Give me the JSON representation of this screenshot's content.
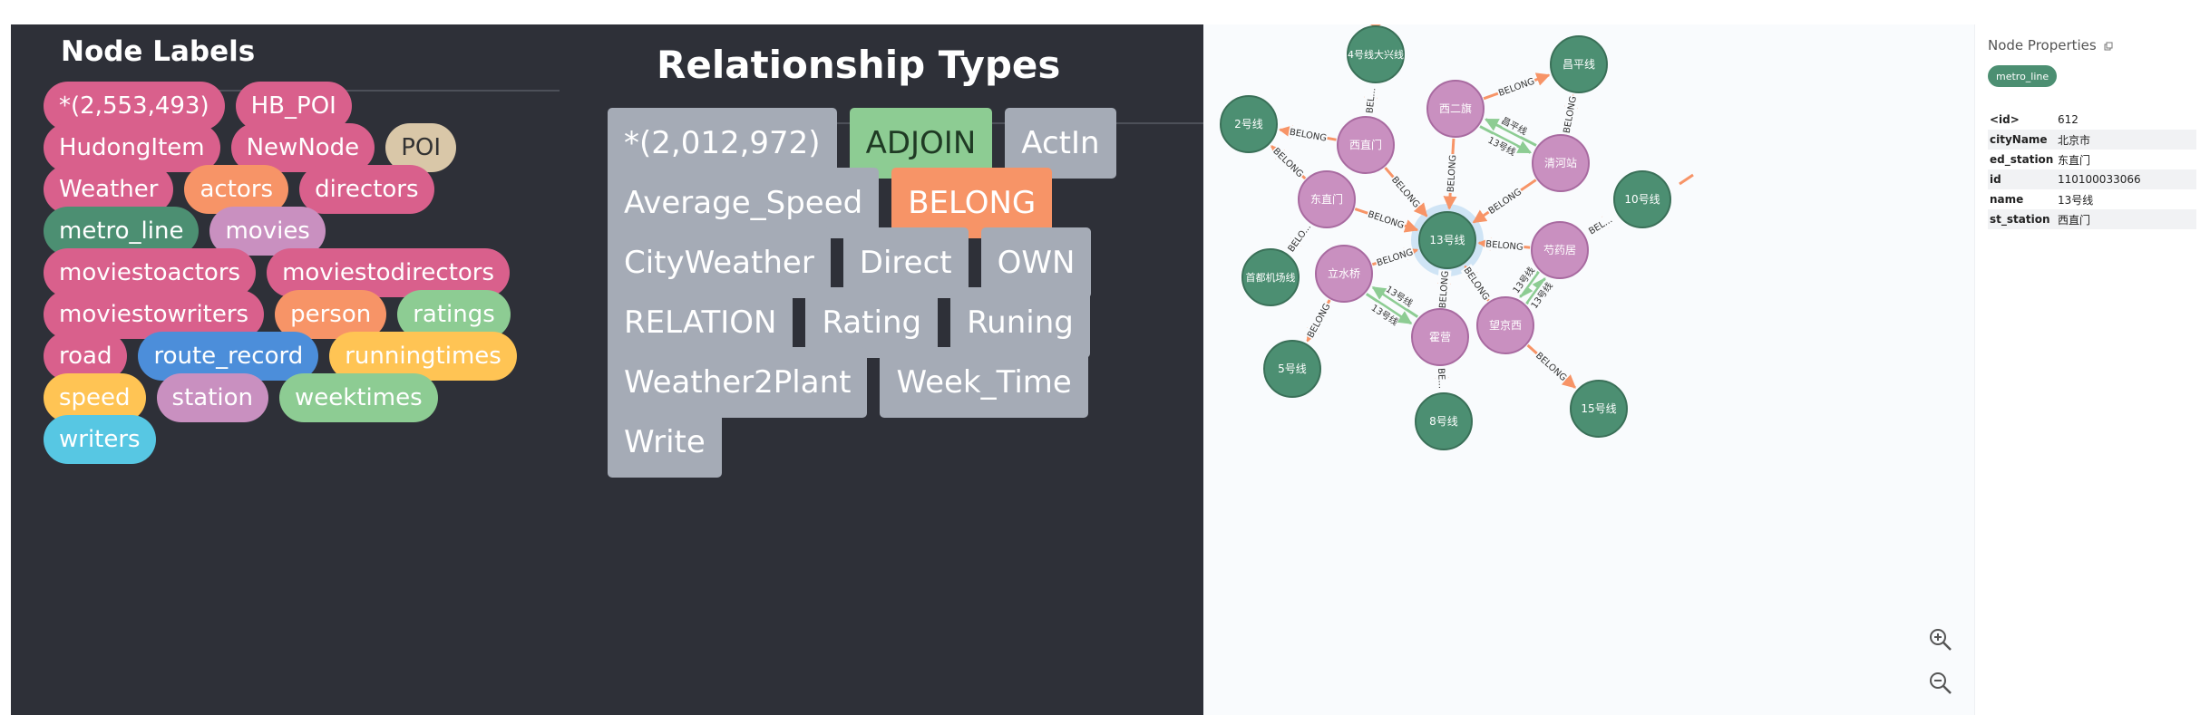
{
  "node_labels": {
    "title": "Node Labels",
    "items": [
      {
        "label": "*(2,553,493)",
        "color": "#d9608c"
      },
      {
        "label": "HB_POI",
        "color": "#d9608c"
      },
      {
        "label": "HudongItem",
        "color": "#d9608c"
      },
      {
        "label": "NewNode",
        "color": "#d9608c"
      },
      {
        "label": "POI",
        "color": "#d9c7a8"
      },
      {
        "label": "Weather",
        "color": "#d9608c"
      },
      {
        "label": "actors",
        "color": "#f79467"
      },
      {
        "label": "directors",
        "color": "#d9608c"
      },
      {
        "label": "metro_line",
        "color": "#4c8f72"
      },
      {
        "label": "movies",
        "color": "#c990c0"
      },
      {
        "label": "moviestoactors",
        "color": "#d9608c"
      },
      {
        "label": "moviestodirectors",
        "color": "#d9608c"
      },
      {
        "label": "moviestowriters",
        "color": "#d9608c"
      },
      {
        "label": "person",
        "color": "#f79467"
      },
      {
        "label": "ratings",
        "color": "#8dcc93"
      },
      {
        "label": "road",
        "color": "#d9608c"
      },
      {
        "label": "route_record",
        "color": "#4c8eda"
      },
      {
        "label": "runningtimes",
        "color": "#ffc454"
      },
      {
        "label": "speed",
        "color": "#ffc454"
      },
      {
        "label": "station",
        "color": "#c990c0"
      },
      {
        "label": "weektimes",
        "color": "#8dcc93"
      },
      {
        "label": "writers",
        "color": "#57c7e3"
      }
    ]
  },
  "relationship_types": {
    "title": "Relationship Types",
    "items": [
      {
        "label": "*(2,012,972)",
        "color": "#a5abb6"
      },
      {
        "label": "ADJOIN",
        "color": "#8dcc93"
      },
      {
        "label": "ActIn",
        "color": "#a5abb6"
      },
      {
        "label": "Average_Speed",
        "color": "#a5abb6"
      },
      {
        "label": "BELONG",
        "color": "#f79467"
      },
      {
        "label": "CityWeather",
        "color": "#a5abb6"
      },
      {
        "label": "Direct",
        "color": "#a5abb6"
      },
      {
        "label": "OWN",
        "color": "#a5abb6"
      },
      {
        "label": "RELATION",
        "color": "#a5abb6"
      },
      {
        "label": "Rating",
        "color": "#a5abb6"
      },
      {
        "label": "Runing",
        "color": "#a5abb6"
      },
      {
        "label": "Weather2Plant",
        "color": "#a5abb6"
      },
      {
        "label": "Week_Time",
        "color": "#a5abb6"
      },
      {
        "label": "Write",
        "color": "#a5abb6"
      }
    ]
  },
  "graph": {
    "colors": {
      "line": "#4c8f72",
      "station": "#c990c0",
      "belong": "#f79467",
      "adjoin": "#8dcc93",
      "selected_halo": "#cfe4f5"
    },
    "nodes": [
      {
        "id": "n13",
        "label": "13号线",
        "type": "line",
        "selected": true
      },
      {
        "id": "n4",
        "label": "4号线大兴线",
        "type": "line"
      },
      {
        "id": "nCp",
        "label": "昌平线",
        "type": "line"
      },
      {
        "id": "n2",
        "label": "2号线",
        "type": "line"
      },
      {
        "id": "n10",
        "label": "10号线",
        "type": "line"
      },
      {
        "id": "nAir",
        "label": "首都机场线",
        "type": "line"
      },
      {
        "id": "n5",
        "label": "5号线",
        "type": "line"
      },
      {
        "id": "n8",
        "label": "8号线",
        "type": "line"
      },
      {
        "id": "n15",
        "label": "15号线",
        "type": "line"
      },
      {
        "id": "sXzm",
        "label": "西直门",
        "type": "station"
      },
      {
        "id": "sXeq",
        "label": "西二旗",
        "type": "station"
      },
      {
        "id": "sQhz",
        "label": "清河站",
        "type": "station"
      },
      {
        "id": "sDzm",
        "label": "东直门",
        "type": "station"
      },
      {
        "id": "sSyj",
        "label": "芍药居",
        "type": "station"
      },
      {
        "id": "sLsq",
        "label": "立水桥",
        "type": "station"
      },
      {
        "id": "sHy",
        "label": "霍营",
        "type": "station"
      },
      {
        "id": "sWjx",
        "label": "望京西",
        "type": "station"
      }
    ],
    "edges": [
      {
        "from": "sXzm",
        "to": "n4",
        "label": "BEL...",
        "type": "belong"
      },
      {
        "from": "sXzm",
        "to": "n2",
        "label": "BELONG",
        "type": "belong"
      },
      {
        "from": "sXzm",
        "to": "n13",
        "label": "BELONG",
        "type": "belong"
      },
      {
        "from": "sXeq",
        "to": "nCp",
        "label": "BELONG",
        "type": "belong"
      },
      {
        "from": "sXeq",
        "to": "n13",
        "label": "BELONG",
        "type": "belong"
      },
      {
        "from": "sXeq",
        "to": "sQhz",
        "label": "13号线",
        "type": "adjoin"
      },
      {
        "from": "sQhz",
        "to": "sXeq",
        "label": "昌平线",
        "type": "adjoin"
      },
      {
        "from": "sQhz",
        "to": "nCp",
        "label": "BELONG",
        "type": "belong"
      },
      {
        "from": "sQhz",
        "to": "n13",
        "label": "BELONG",
        "type": "belong"
      },
      {
        "from": "sDzm",
        "to": "n2",
        "label": "BELONG",
        "type": "belong"
      },
      {
        "from": "sDzm",
        "to": "n13",
        "label": "BELONG",
        "type": "belong"
      },
      {
        "from": "sDzm",
        "to": "nAir",
        "label": "BELO...",
        "type": "belong"
      },
      {
        "from": "sSyj",
        "to": "n13",
        "label": "BELONG",
        "type": "belong"
      },
      {
        "from": "sSyj",
        "to": "n10",
        "label": "BEL...",
        "type": "belong"
      },
      {
        "from": "sLsq",
        "to": "n13",
        "label": "BELONG",
        "type": "belong"
      },
      {
        "from": "sLsq",
        "to": "n5",
        "label": "BELONG",
        "type": "belong"
      },
      {
        "from": "sLsq",
        "to": "sHy",
        "label": "13号线",
        "type": "adjoin"
      },
      {
        "from": "sHy",
        "to": "sLsq",
        "label": "13号线",
        "type": "adjoin"
      },
      {
        "from": "sHy",
        "to": "n13",
        "label": "BELONG",
        "type": "belong"
      },
      {
        "from": "sHy",
        "to": "n8",
        "label": "BE...",
        "type": "belong"
      },
      {
        "from": "sWjx",
        "to": "n13",
        "label": "BELONG",
        "type": "belong"
      },
      {
        "from": "sWjx",
        "to": "n15",
        "label": "BELONG",
        "type": "belong"
      },
      {
        "from": "sWjx",
        "to": "sSyj",
        "label": "13号线",
        "type": "adjoin"
      },
      {
        "from": "sSyj",
        "to": "sWjx",
        "label": "13号线",
        "type": "adjoin"
      }
    ]
  },
  "zoom": {
    "in_icon": "zoom-in-icon",
    "out_icon": "zoom-out-icon"
  },
  "properties": {
    "title": "Node Properties",
    "copy_icon": "copy-icon",
    "badge": "metro_line",
    "rows": [
      {
        "key": "<id>",
        "value": "612"
      },
      {
        "key": "cityName",
        "value": "北京市"
      },
      {
        "key": "ed_station",
        "value": "东直门"
      },
      {
        "key": "id",
        "value": "110100033066"
      },
      {
        "key": "name",
        "value": "13号线"
      },
      {
        "key": "st_station",
        "value": "西直门"
      }
    ]
  }
}
